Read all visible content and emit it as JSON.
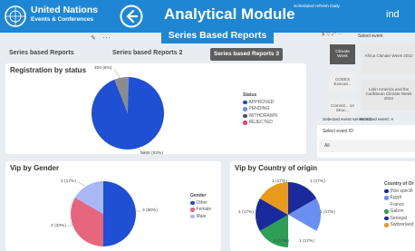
{
  "header": {
    "org_name": "United Nations",
    "org_sub": "Events & Conferences",
    "title": "Analytical Module",
    "scheduled": "Scheduled refresh Daily",
    "right_text": "ind",
    "series_title": "Series Based Reports"
  },
  "tabs": [
    "Series based Reports",
    "Series based Reports 2",
    "Series based Reports 3"
  ],
  "registration": {
    "title": "Registration by status",
    "legend_title": "Status",
    "legend": [
      {
        "label": "APPROVED",
        "color": "#1f4fd3"
      },
      {
        "label": "PENDING",
        "color": "#6b8ff0"
      },
      {
        "label": "WITHDRAWN",
        "color": "#555555"
      },
      {
        "label": "REJECTED",
        "color": "#e0457b"
      }
    ],
    "label_small": "400 (6%)",
    "label_big": "5968 (93%)"
  },
  "gender": {
    "title": "Vip by Gender",
    "legend_title": "Gender",
    "legend": [
      {
        "label": "Other",
        "color": "#1f4fd3"
      },
      {
        "label": "Female",
        "color": "#e8667d"
      },
      {
        "label": "Male",
        "color": "#a9b8f5"
      }
    ],
    "labels": [
      "1 (17%)",
      "3 (50%)",
      "2 (33%)"
    ]
  },
  "country": {
    "title": "Vip by Country of origin",
    "legend_title": "Country of Or",
    "legend": [
      {
        "label": "(Not specifi",
        "color": "#1a2a9c"
      },
      {
        "label": "Egypt",
        "color": "#6b8ff0"
      },
      {
        "label": "France",
        "color": "#ffffff"
      },
      {
        "label": "Gabon",
        "color": "#2e9e55"
      },
      {
        "label": "Senegal",
        "color": "#5a3fc0"
      },
      {
        "label": "Switzerland",
        "color": "#e89a1a"
      }
    ],
    "labels": [
      "1 (17%)",
      "1 (17%)",
      "1 (17%)",
      "1 (17%)",
      "1 (17%)",
      "1 (17%)"
    ]
  },
  "right_panel": {
    "select_event": "Select event",
    "tiles": [
      "Climate Week",
      "CODEX Executi...",
      "Commit... on Struc..."
    ],
    "events": [
      "Africa Climate Week 2022",
      "Latin America and the Caribbean Climate Week 2022"
    ],
    "selected_series": "Selected event series: Cl...",
    "selected_event": "Selected event: A",
    "select_id_label": "Select event ID",
    "select_id_value": "All"
  },
  "chart_data": [
    {
      "type": "pie",
      "title": "Registration by status",
      "categories": [
        "APPROVED",
        "PENDING",
        "WITHDRAWN",
        "REJECTED"
      ],
      "values": [
        5968,
        0,
        400,
        0
      ]
    },
    {
      "type": "pie",
      "title": "Vip by Gender",
      "categories": [
        "Other",
        "Female",
        "Male"
      ],
      "values": [
        3,
        2,
        1
      ]
    },
    {
      "type": "pie",
      "title": "Vip by Country of origin",
      "categories": [
        "(Not specified)",
        "Egypt",
        "France",
        "Gabon",
        "Senegal",
        "Switzerland"
      ],
      "values": [
        1,
        1,
        1,
        1,
        1,
        1
      ]
    }
  ]
}
